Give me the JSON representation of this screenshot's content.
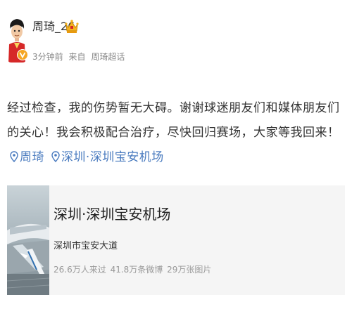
{
  "post": {
    "author": {
      "name": "周琦_26"
    },
    "meta": {
      "time": "3分钟前",
      "source_prefix": "来自",
      "source": "周琦超话"
    },
    "text": "经过检查，我的伤势暂无大碍。谢谢球迷朋友们和媒体朋友们的关心！我会积极配合治疗，尽快回归赛场，大家等我回来！",
    "mention": "周琦",
    "location_link": "深圳·深圳宝安机场"
  },
  "location_card": {
    "title": "深圳·深圳宝安机场",
    "address": "深圳市宝安大道",
    "stats": {
      "visitors": "26.6万人来过",
      "posts": "41.8万条微博",
      "photos": "29万张图片"
    }
  },
  "colors": {
    "link": "#4a7bbf",
    "meta_text": "#888888",
    "card_bg": "#f5f5f5",
    "badge": "#f5a623"
  },
  "icons": {
    "crown": "crown-icon",
    "location": "location-pin-icon",
    "vip": "vip-badge-icon"
  }
}
